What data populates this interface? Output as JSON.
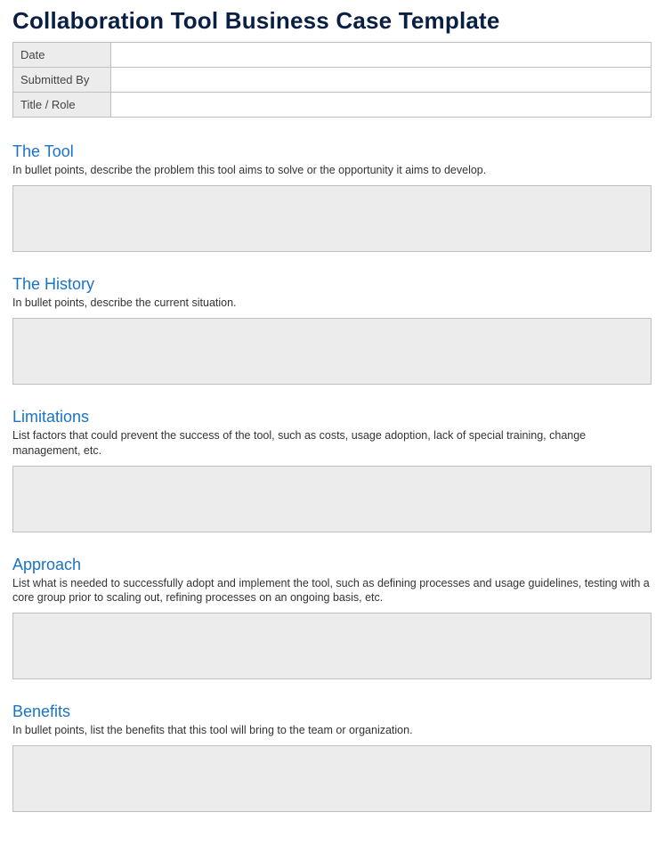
{
  "title": "Collaboration Tool Business Case Template",
  "meta": {
    "date_label": "Date",
    "date_value": "",
    "submitted_by_label": "Submitted By",
    "submitted_by_value": "",
    "title_role_label": "Title / Role",
    "title_role_value": ""
  },
  "sections": {
    "tool": {
      "heading": "The Tool",
      "description": "In bullet points, describe the problem this tool aims to solve or the opportunity it aims to develop.",
      "content": ""
    },
    "history": {
      "heading": "The History",
      "description": "In bullet points, describe the current situation.",
      "content": ""
    },
    "limitations": {
      "heading": "Limitations",
      "description": "List factors that could prevent the success of the tool, such as costs, usage adoption, lack of special training, change management, etc.",
      "content": ""
    },
    "approach": {
      "heading": "Approach",
      "description": "List what is needed to successfully adopt and implement the tool, such as defining processes and usage guidelines, testing with a core group prior to scaling out, refining processes on an ongoing basis, etc.",
      "content": ""
    },
    "benefits": {
      "heading": "Benefits",
      "description": "In bullet points, list the benefits that this tool will bring to the team or organization.",
      "content": ""
    }
  }
}
